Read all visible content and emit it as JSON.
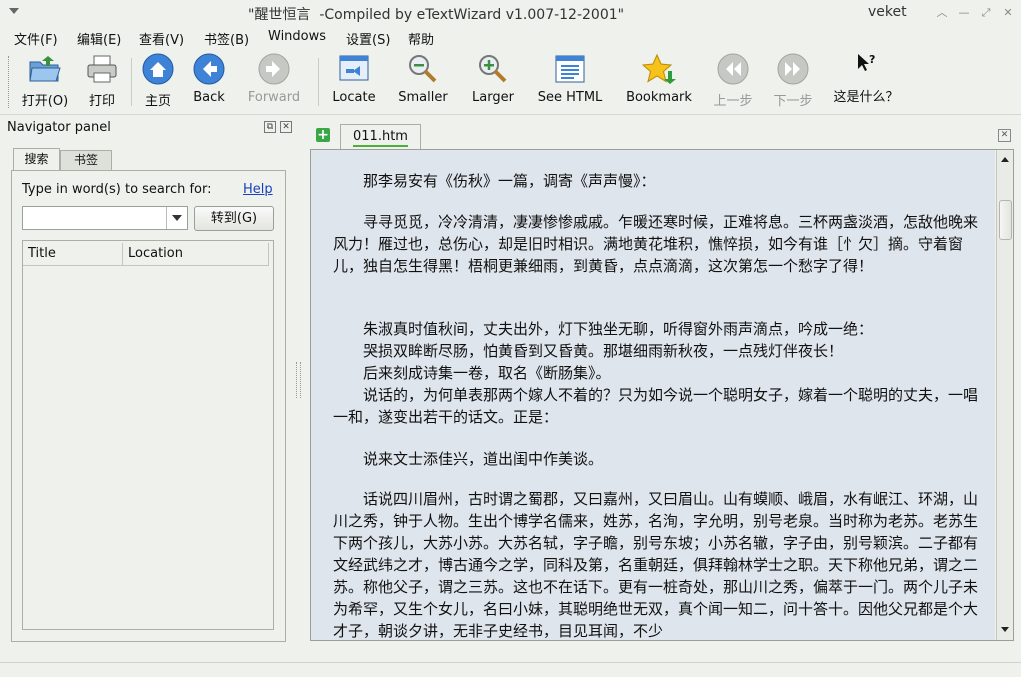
{
  "window": {
    "title": "\"醒世恒言  -Compiled by eTextWizard v1.007-12-2001\"",
    "user": "veket"
  },
  "menu": [
    "文件(F)",
    "编辑(E)",
    "查看(V)",
    "书签(B)",
    "Windows",
    "设置(S)",
    "帮助"
  ],
  "toolbar": {
    "open": "打开(O)",
    "print": "打印",
    "home": "主页",
    "back": "Back",
    "forward": "Forward",
    "locate": "Locate",
    "smaller": "Smaller",
    "larger": "Larger",
    "see_html": "See HTML",
    "bookmark": "Bookmark",
    "prev": "上一步",
    "next": "下一步",
    "whatsthis": "这是什么？"
  },
  "navigator": {
    "title": "Navigator panel",
    "tabs": [
      "搜索",
      "书签"
    ],
    "search_label": "Type in word(s) to search for:",
    "help": "Help",
    "search_value": "",
    "goto": "转到(G)",
    "columns": [
      "Title",
      "Location"
    ]
  },
  "doc": {
    "tab": "011.htm",
    "paragraphs": [
      "　　那李易安有《伤秋》一篇，调寄《声声慢》：",
      "　　寻寻觅觅，冷冷清清，凄凄惨惨戚戚。乍暖还寒时候，正难将息。三杯两盏淡酒，怎敌他晚来风力！雁过也，总伤心，却是旧时相识。满地黄花堆积，憔悴损，如今有谁［忄欠］摘。守着窗儿，独自怎生得黑！梧桐更兼细雨，到黄昏，点点滴滴，这次第怎一个愁字了得！",
      "　　朱淑真时值秋间，丈夫出外，灯下独坐无聊，听得窗外雨声滴点，吟成一绝：",
      "　　哭损双眸断尽肠，怕黄昏到又昏黄。那堪细雨新秋夜，一点残灯伴夜长！",
      "　　后来刻成诗集一卷，取名《断肠集》。",
      "　　说话的，为何单表那两个嫁人不着的？只为如今说一个聪明女子，嫁着一个聪明的丈夫，一唱一和，遂变出若干的话文。正是：",
      "　　说来文士添佳兴，道出闺中作美谈。",
      "　　话说四川眉州，古时谓之蜀郡，又曰嘉州，又曰眉山。山有蟆顺、峨眉，水有岷江、环湖，山川之秀，钟于人物。生出个博学名儒来，姓苏，名洵，字允明，别号老泉。当时称为老苏。老苏生下两个孩儿，大苏小苏。大苏名轼，字子瞻，别号东坡；小苏名辙，字子由，别号颖滨。二子都有文经武纬之才，博古通今之学，同科及第，名重朝廷，俱拜翰林学士之职。天下称他兄弟，谓之二苏。称他父子，谓之三苏。这也不在话下。更有一桩奇处，那山川之秀，偏萃于一门。两个儿子未为希罕，又生个女儿，名曰小妹，其聪明绝世无双，真个闻一知二，问十答十。因他父兄都是个大才子，朝谈夕讲，无非子史经书，目见耳闻，不少"
    ]
  }
}
